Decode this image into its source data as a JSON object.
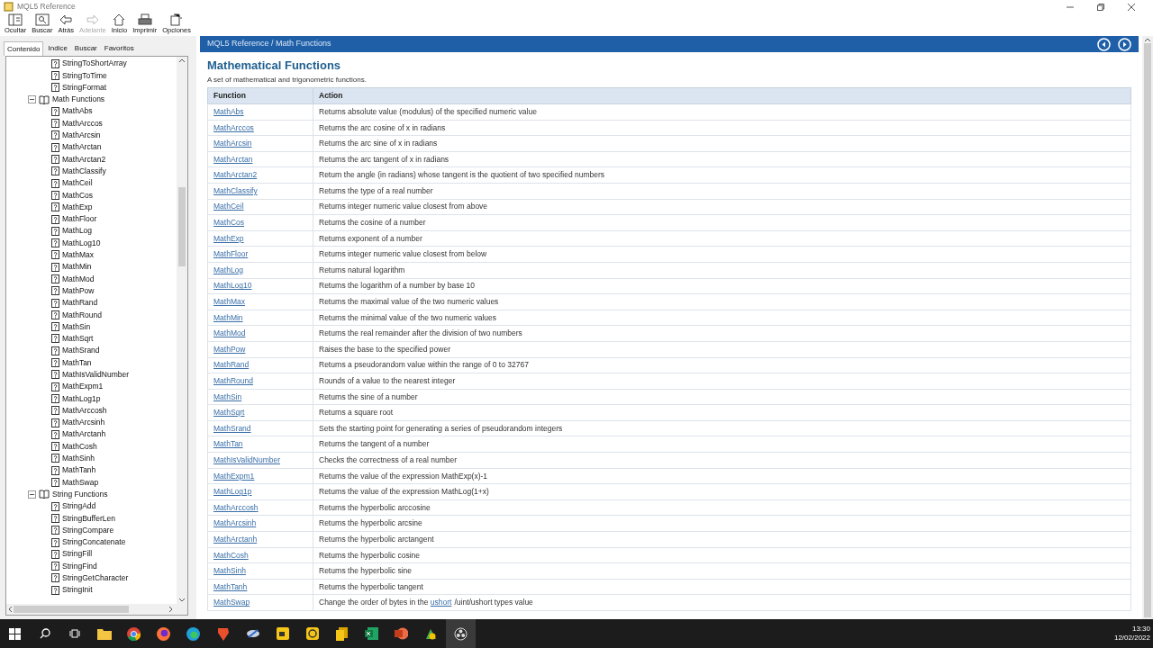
{
  "window": {
    "title": "MQL5 Reference"
  },
  "toolbar": [
    {
      "label": "Ocultar",
      "kind": "hide",
      "disabled": false
    },
    {
      "label": "Buscar",
      "kind": "find",
      "disabled": false
    },
    {
      "label": "Atrás",
      "kind": "back",
      "disabled": false
    },
    {
      "label": "Adelante",
      "kind": "forward",
      "disabled": true
    },
    {
      "label": "Inicio",
      "kind": "home",
      "disabled": false
    },
    {
      "label": "Imprimir",
      "kind": "print",
      "disabled": false
    },
    {
      "label": "Opciones",
      "kind": "options",
      "disabled": false
    }
  ],
  "sidebar": {
    "tabs": [
      {
        "label": "Contenido",
        "selected": true
      },
      {
        "label": "Indice",
        "selected": false
      },
      {
        "label": "Buscar",
        "selected": false
      },
      {
        "label": "Favoritos",
        "selected": false
      }
    ],
    "tree": [
      {
        "kind": "page",
        "label": "StringToShortArray"
      },
      {
        "kind": "page",
        "label": "StringToTime"
      },
      {
        "kind": "page",
        "label": "StringFormat"
      },
      {
        "kind": "book",
        "label": "Math Functions",
        "expanded": true,
        "children": [
          {
            "kind": "page",
            "label": "MathAbs"
          },
          {
            "kind": "page",
            "label": "MathArccos"
          },
          {
            "kind": "page",
            "label": "MathArcsin"
          },
          {
            "kind": "page",
            "label": "MathArctan"
          },
          {
            "kind": "page",
            "label": "MathArctan2"
          },
          {
            "kind": "page",
            "label": "MathClassify"
          },
          {
            "kind": "page",
            "label": "MathCeil"
          },
          {
            "kind": "page",
            "label": "MathCos"
          },
          {
            "kind": "page",
            "label": "MathExp"
          },
          {
            "kind": "page",
            "label": "MathFloor"
          },
          {
            "kind": "page",
            "label": "MathLog"
          },
          {
            "kind": "page",
            "label": "MathLog10"
          },
          {
            "kind": "page",
            "label": "MathMax"
          },
          {
            "kind": "page",
            "label": "MathMin"
          },
          {
            "kind": "page",
            "label": "MathMod"
          },
          {
            "kind": "page",
            "label": "MathPow"
          },
          {
            "kind": "page",
            "label": "MathRand"
          },
          {
            "kind": "page",
            "label": "MathRound"
          },
          {
            "kind": "page",
            "label": "MathSin"
          },
          {
            "kind": "page",
            "label": "MathSqrt"
          },
          {
            "kind": "page",
            "label": "MathSrand"
          },
          {
            "kind": "page",
            "label": "MathTan"
          },
          {
            "kind": "page",
            "label": "MathIsValidNumber"
          },
          {
            "kind": "page",
            "label": "MathExpm1"
          },
          {
            "kind": "page",
            "label": "MathLog1p"
          },
          {
            "kind": "page",
            "label": "MathArccosh"
          },
          {
            "kind": "page",
            "label": "MathArcsinh"
          },
          {
            "kind": "page",
            "label": "MathArctanh"
          },
          {
            "kind": "page",
            "label": "MathCosh"
          },
          {
            "kind": "page",
            "label": "MathSinh"
          },
          {
            "kind": "page",
            "label": "MathTanh"
          },
          {
            "kind": "page",
            "label": "MathSwap"
          }
        ]
      },
      {
        "kind": "book",
        "label": "String Functions",
        "expanded": true,
        "children": [
          {
            "kind": "page",
            "label": "StringAdd"
          },
          {
            "kind": "page",
            "label": "StringBufferLen"
          },
          {
            "kind": "page",
            "label": "StringCompare"
          },
          {
            "kind": "page",
            "label": "StringConcatenate"
          },
          {
            "kind": "page",
            "label": "StringFill"
          },
          {
            "kind": "page",
            "label": "StringFind"
          },
          {
            "kind": "page",
            "label": "StringGetCharacter"
          },
          {
            "kind": "page",
            "label": "StringInit"
          }
        ]
      }
    ]
  },
  "content": {
    "breadcrumb": "MQL5 Reference / Math Functions",
    "title": "Mathematical Functions",
    "description": "A set of mathematical and trigonometric functions.",
    "table": {
      "columns": [
        "Function",
        "Action"
      ],
      "rows": [
        {
          "function": "MathAbs",
          "action": [
            {
              "kind": "text",
              "text": "Returns absolute value (modulus) of the specified numeric value"
            }
          ]
        },
        {
          "function": "MathArccos",
          "action": [
            {
              "kind": "text",
              "text": "Returns the arc cosine of x in radians"
            }
          ]
        },
        {
          "function": "MathArcsin",
          "action": [
            {
              "kind": "text",
              "text": "Returns the arc sine of x in radians"
            }
          ]
        },
        {
          "function": "MathArctan",
          "action": [
            {
              "kind": "text",
              "text": "Returns the arc tangent of x in radians"
            }
          ]
        },
        {
          "function": "MathArctan2",
          "action": [
            {
              "kind": "text",
              "text": "Return the angle (in radians) whose tangent is the quotient of two specified numbers"
            }
          ]
        },
        {
          "function": "MathClassify",
          "action": [
            {
              "kind": "text",
              "text": "Returns the type of a real number"
            }
          ]
        },
        {
          "function": "MathCeil",
          "action": [
            {
              "kind": "text",
              "text": "Returns integer numeric value closest from above"
            }
          ]
        },
        {
          "function": "MathCos",
          "action": [
            {
              "kind": "text",
              "text": "Returns the cosine of a number"
            }
          ]
        },
        {
          "function": "MathExp",
          "action": [
            {
              "kind": "text",
              "text": "Returns exponent of a number"
            }
          ]
        },
        {
          "function": "MathFloor",
          "action": [
            {
              "kind": "text",
              "text": "Returns integer numeric value closest from below"
            }
          ]
        },
        {
          "function": "MathLog",
          "action": [
            {
              "kind": "text",
              "text": "Returns natural logarithm"
            }
          ]
        },
        {
          "function": "MathLog10",
          "action": [
            {
              "kind": "text",
              "text": "Returns the logarithm of a number by base 10"
            }
          ]
        },
        {
          "function": "MathMax",
          "action": [
            {
              "kind": "text",
              "text": "Returns the maximal value of the two numeric values"
            }
          ]
        },
        {
          "function": "MathMin",
          "action": [
            {
              "kind": "text",
              "text": "Returns the minimal value of the two numeric values"
            }
          ]
        },
        {
          "function": "MathMod",
          "action": [
            {
              "kind": "text",
              "text": "Returns the real remainder after the division of two numbers"
            }
          ]
        },
        {
          "function": "MathPow",
          "action": [
            {
              "kind": "text",
              "text": "Raises the base to the specified power"
            }
          ]
        },
        {
          "function": "MathRand",
          "action": [
            {
              "kind": "text",
              "text": "Returns a pseudorandom value within the range of 0 to 32767"
            }
          ]
        },
        {
          "function": "MathRound",
          "action": [
            {
              "kind": "text",
              "text": "Rounds of a value to the nearest integer"
            }
          ]
        },
        {
          "function": "MathSin",
          "action": [
            {
              "kind": "text",
              "text": "Returns the sine of a number"
            }
          ]
        },
        {
          "function": "MathSqrt",
          "action": [
            {
              "kind": "text",
              "text": "Returns a square root"
            }
          ]
        },
        {
          "function": "MathSrand",
          "action": [
            {
              "kind": "text",
              "text": "Sets the starting point for generating a series of pseudorandom integers"
            }
          ]
        },
        {
          "function": "MathTan",
          "action": [
            {
              "kind": "text",
              "text": "Returns the tangent of a number"
            }
          ]
        },
        {
          "function": "MathIsValidNumber",
          "action": [
            {
              "kind": "text",
              "text": "Checks the correctness of a real number"
            }
          ]
        },
        {
          "function": "MathExpm1",
          "action": [
            {
              "kind": "text",
              "text": "Returns the value of the expression MathExp(x)-1"
            }
          ]
        },
        {
          "function": "MathLog1p",
          "action": [
            {
              "kind": "text",
              "text": "Returns the value of the expression MathLog(1+x)"
            }
          ]
        },
        {
          "function": "MathArccosh",
          "action": [
            {
              "kind": "text",
              "text": "Returns the hyperbolic arccosine"
            }
          ]
        },
        {
          "function": "MathArcsinh",
          "action": [
            {
              "kind": "text",
              "text": "Returns the hyperbolic arcsine"
            }
          ]
        },
        {
          "function": "MathArctanh",
          "action": [
            {
              "kind": "text",
              "text": "Returns the hyperbolic arctangent"
            }
          ]
        },
        {
          "function": "MathCosh",
          "action": [
            {
              "kind": "text",
              "text": "Returns the hyperbolic cosine"
            }
          ]
        },
        {
          "function": "MathSinh",
          "action": [
            {
              "kind": "text",
              "text": "Returns the hyperbolic sine"
            }
          ]
        },
        {
          "function": "MathTanh",
          "action": [
            {
              "kind": "text",
              "text": "Returns the hyperbolic tangent"
            }
          ]
        },
        {
          "function": "MathSwap",
          "action": [
            {
              "kind": "text",
              "text": "Change the order of bytes in the "
            },
            {
              "kind": "link",
              "text": "ushort"
            },
            {
              "kind": "text",
              "text": "/uint/ushort types value"
            }
          ]
        }
      ]
    }
  },
  "taskbar": {
    "clock": {
      "time": "13:30",
      "date": "12/02/2022"
    }
  }
}
